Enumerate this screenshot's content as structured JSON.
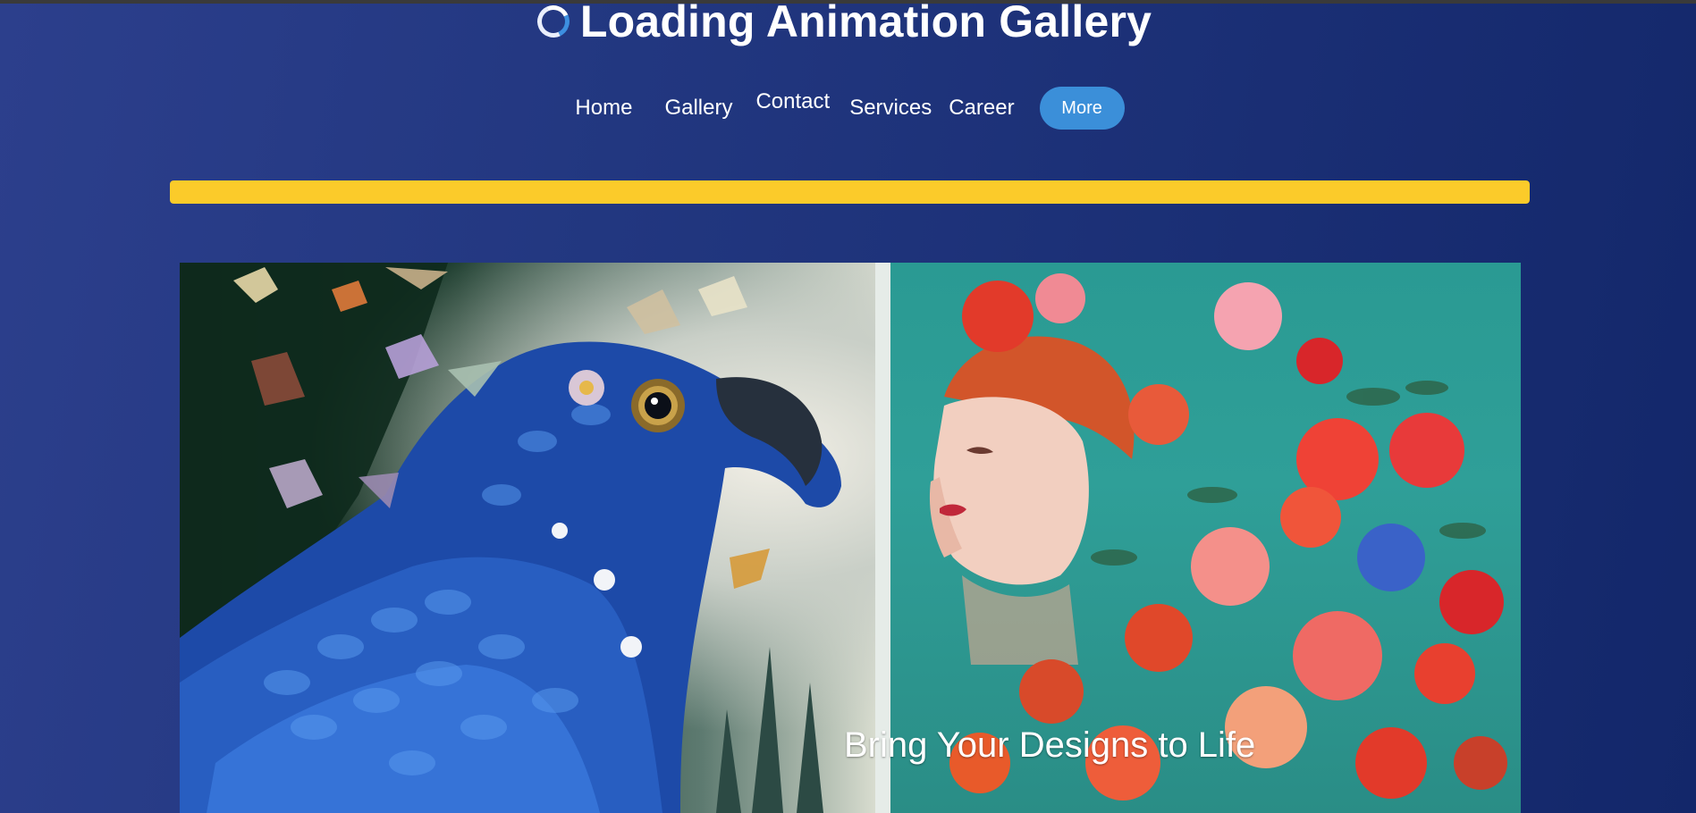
{
  "header": {
    "title": "Loading Animation Gallery",
    "logo_icon": "loading-spinner-icon"
  },
  "nav": {
    "items": [
      {
        "label": "Home"
      },
      {
        "label": "Gallery"
      },
      {
        "label": "Contact"
      },
      {
        "label": "Services"
      },
      {
        "label": "Career"
      }
    ],
    "more_label": "More"
  },
  "progress": {
    "value_percent": 100,
    "color": "#fbcb2a"
  },
  "gallery": {
    "caption": "Bring Your Designs to Life",
    "images": [
      {
        "subject": "blue-bird-with-butterflies"
      },
      {
        "subject": "woman-with-flowers"
      }
    ]
  },
  "colors": {
    "background_start": "#2c3f8c",
    "background_end": "#13276a",
    "accent": "#3b8fd9",
    "progress": "#fbcb2a"
  }
}
